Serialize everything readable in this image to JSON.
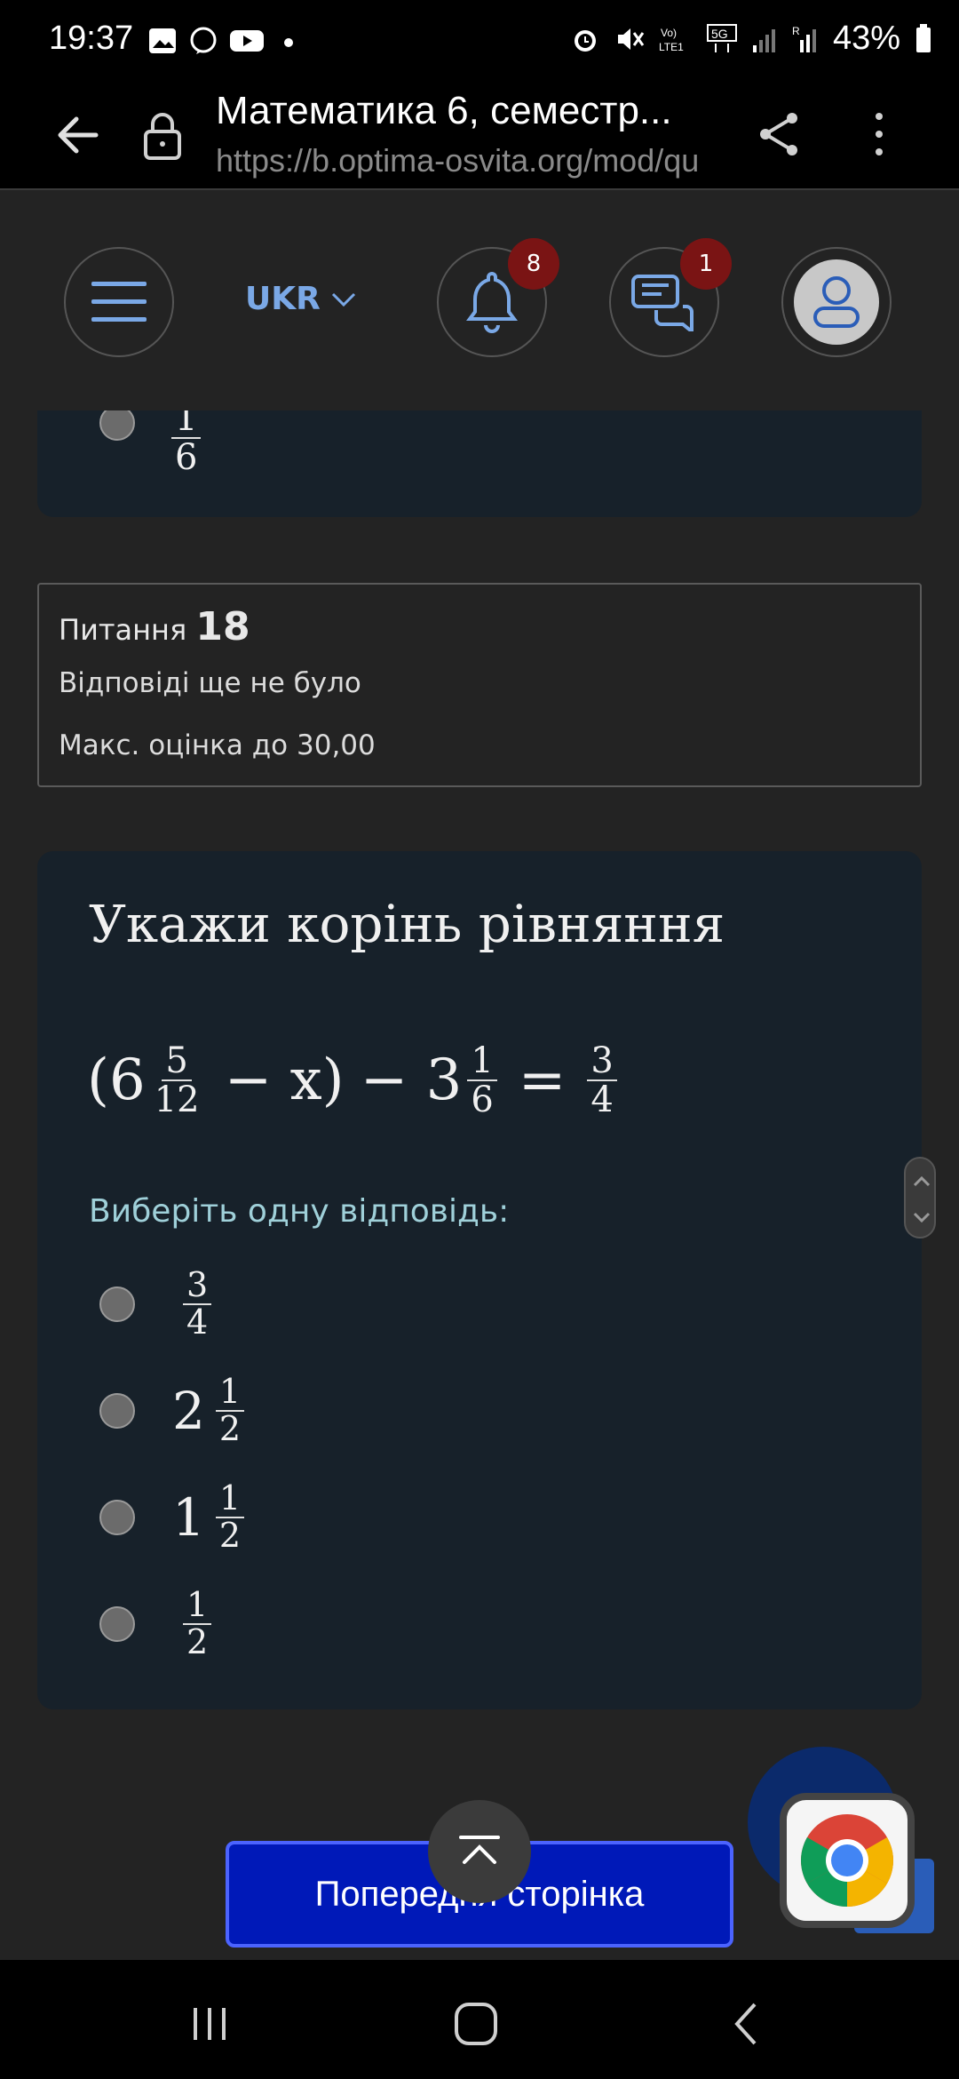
{
  "status_bar": {
    "time": "19:37",
    "notification_icons": [
      "image-icon",
      "viber-icon",
      "youtube-icon",
      "dot-icon"
    ],
    "system_icons": [
      "alarm-icon",
      "mute-icon",
      "volte-icon",
      "5g-icon",
      "signal-icon",
      "signal-roaming-icon"
    ],
    "battery": "43%"
  },
  "browser": {
    "page_title": "Математика 6, семестр...",
    "url": "https://b.optima-osvita.org/mod/qu"
  },
  "site_header": {
    "language": "UKR",
    "notifications_count": "8",
    "messages_count": "1"
  },
  "previous_question": {
    "last_answer": {
      "numerator": "1",
      "denominator": "6"
    }
  },
  "question_info": {
    "label": "Питання",
    "number": "18",
    "state": "Відповіді ще не було",
    "grade": "Макс. оцінка до 30,00"
  },
  "question": {
    "title": "Укажи корінь рівняння",
    "equation": {
      "open": "(6",
      "frac1": {
        "num": "5",
        "den": "12"
      },
      "minus_x": "− x)",
      "minus_three": "− 3",
      "frac2": {
        "num": "1",
        "den": "6"
      },
      "equals": "=",
      "frac3": {
        "num": "3",
        "den": "4"
      }
    },
    "prompt": "Виберіть одну відповідь:",
    "answers": [
      {
        "whole": "",
        "num": "3",
        "den": "4"
      },
      {
        "whole": "2",
        "num": "1",
        "den": "2"
      },
      {
        "whole": "1",
        "num": "1",
        "den": "2"
      },
      {
        "whole": "",
        "num": "1",
        "den": "2"
      }
    ]
  },
  "footer": {
    "previous_page": "Попередня сторінка"
  },
  "colors": {
    "page_bg": "#232323",
    "card_bg": "#17212a",
    "accent_blue": "#0019b8",
    "badge_red": "#7a1414",
    "prompt_teal": "#9fd0d9"
  }
}
